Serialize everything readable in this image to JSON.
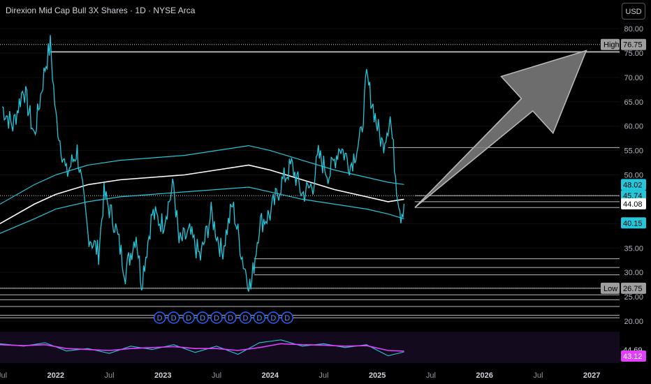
{
  "header": {
    "title": "Direxion Mid Cap Bull 3X Shares · 1D · NYSE Arca",
    "currency": "USD"
  },
  "colors": {
    "price": "#26c6da",
    "ma_mid": "#ffffff",
    "bands": "#26c6da",
    "rsi_main": "#e040fb",
    "rsi_signal": "#26c6da",
    "arrow_fill": "#808080",
    "background": "#000000"
  },
  "chart_data": [
    {
      "type": "line",
      "title": "Direxion Mid Cap Bull 3X Shares · 1D · NYSE Arca",
      "ylim": [
        20,
        82
      ],
      "y_ticks": [
        20,
        25,
        30,
        35,
        40,
        45,
        50,
        55,
        60,
        65,
        70,
        75,
        80
      ],
      "y_tick_labels": [
        "20.00",
        "25.00",
        "30.00",
        "35.00",
        "40.00",
        "45.00",
        "50.00",
        "55.00",
        "60.00",
        "65.00",
        "70.00",
        "75.00",
        "80.00"
      ],
      "x_tick_labels": [
        "Jul",
        "2022",
        "Jul",
        "2023",
        "Jul",
        "2024",
        "Jul",
        "2025",
        "Jul",
        "2026",
        "Jul",
        "2027"
      ],
      "x_ticks": [
        2021.5,
        2022.0,
        2022.5,
        2023.0,
        2023.5,
        2024.0,
        2024.5,
        2025.0,
        2025.5,
        2026.0,
        2026.5,
        2027.0
      ],
      "xlim": [
        2021.48,
        2027.26
      ],
      "series": [
        {
          "x": [
            2021.5,
            2021.6,
            2021.7,
            2021.8,
            2021.9,
            2021.95,
            2022.0,
            2022.1,
            2022.2,
            2022.3,
            2022.4,
            2022.45,
            2022.55,
            2022.65,
            2022.75,
            2022.8,
            2022.9,
            2023.0,
            2023.1,
            2023.15,
            2023.25,
            2023.35,
            2023.45,
            2023.55,
            2023.65,
            2023.7,
            2023.75,
            2023.82,
            2023.9,
            2024.0,
            2024.1,
            2024.2,
            2024.3,
            2024.4,
            2024.45,
            2024.55,
            2024.65,
            2024.75,
            2024.85,
            2024.9,
            2025.0,
            2025.05,
            2025.12,
            2025.18,
            2025.22,
            2025.25
          ],
          "values": [
            64,
            60,
            68,
            58,
            72,
            76.75,
            62,
            50,
            55,
            38,
            34,
            46,
            40,
            30,
            38,
            28,
            42,
            40,
            48,
            36,
            38,
            33,
            42,
            34,
            44,
            38,
            32,
            26.75,
            40,
            42,
            48,
            52,
            46,
            48,
            54,
            50,
            56,
            52,
            58,
            70,
            60,
            56,
            62,
            48,
            42,
            44.08
          ]
        },
        {
          "name": "",
          "x": [
            2021.48,
            2021.8,
            2022.0,
            2022.3,
            2022.6,
            2022.9,
            2023.2,
            2023.5,
            2023.8,
            2024.0,
            2024.3,
            2024.6,
            2024.9,
            2025.1,
            2025.25
          ],
          "values": [
            40,
            44,
            46,
            48,
            49,
            49.5,
            50,
            51,
            52,
            51,
            49,
            47,
            45.5,
            44.5,
            45
          ]
        },
        {
          "name": "",
          "x": [
            2021.48,
            2021.8,
            2022.0,
            2022.3,
            2022.6,
            2022.9,
            2023.2,
            2023.5,
            2023.8,
            2024.0,
            2024.3,
            2024.6,
            2024.9,
            2025.1,
            2025.25
          ],
          "values": [
            44,
            48,
            50,
            52,
            53,
            53.5,
            54,
            55,
            56,
            55,
            53,
            51,
            49.5,
            48.5,
            48.02
          ]
        },
        {
          "name": "",
          "x": [
            2021.48,
            2021.8,
            2022.0,
            2022.3,
            2022.6,
            2022.9,
            2023.2,
            2023.5,
            2023.8,
            2024.0,
            2024.3,
            2024.6,
            2024.9,
            2025.1,
            2025.25
          ],
          "values": [
            38,
            41,
            43,
            44.5,
            45.5,
            46,
            46.5,
            47,
            47.5,
            46.5,
            45,
            44,
            43,
            42,
            41
          ]
        }
      ],
      "horizontal_levels": [
        76.75,
        75.3,
        55.6,
        45.74,
        44.5,
        43.3,
        32.8,
        31.0,
        29.5,
        26.75,
        25.4,
        24.4,
        23.0,
        21.2,
        20.7
      ],
      "price_labels": [
        {
          "text": "76.75",
          "value": 76.75,
          "tag": "High"
        },
        {
          "text": "48.02",
          "value": 48.02
        },
        {
          "text": "45.74",
          "value": 45.74
        },
        {
          "text": "44.08",
          "value": 44.08
        },
        {
          "text": "40.15",
          "value": 40.15
        },
        {
          "text": "26.75",
          "value": 26.75,
          "tag": "Low"
        }
      ],
      "dividends": {
        "label": "D",
        "x": [
          2022.97,
          2023.1,
          2023.24,
          2023.37,
          2023.5,
          2023.63,
          2023.77,
          2023.9,
          2024.03,
          2024.16
        ]
      },
      "annotation": {
        "type": "arrow",
        "from_x": 2025.35,
        "from_y": 43.3,
        "to_x": 2026.95,
        "to_y": 75.5
      }
    },
    {
      "type": "line",
      "title": "",
      "ylim": [
        20,
        85
      ],
      "x": [
        2021.48,
        2021.7,
        2021.9,
        2022.1,
        2022.3,
        2022.5,
        2022.7,
        2022.9,
        2023.1,
        2023.3,
        2023.5,
        2023.7,
        2023.9,
        2024.1,
        2024.3,
        2024.5,
        2024.7,
        2024.9,
        2025.1,
        2025.25
      ],
      "series": [
        {
          "values": [
            60,
            55,
            62,
            45,
            50,
            40,
            55,
            48,
            58,
            42,
            55,
            38,
            62,
            68,
            55,
            60,
            52,
            58,
            35,
            43.12
          ]
        },
        {
          "values": [
            58,
            56,
            58,
            50,
            48,
            46,
            50,
            52,
            54,
            50,
            50,
            46,
            52,
            60,
            58,
            57,
            55,
            56,
            46,
            44.69
          ]
        }
      ],
      "price_labels": [
        {
          "text": "44.69",
          "value": 44.69
        },
        {
          "text": "43.12",
          "value": 43.12
        }
      ]
    }
  ]
}
